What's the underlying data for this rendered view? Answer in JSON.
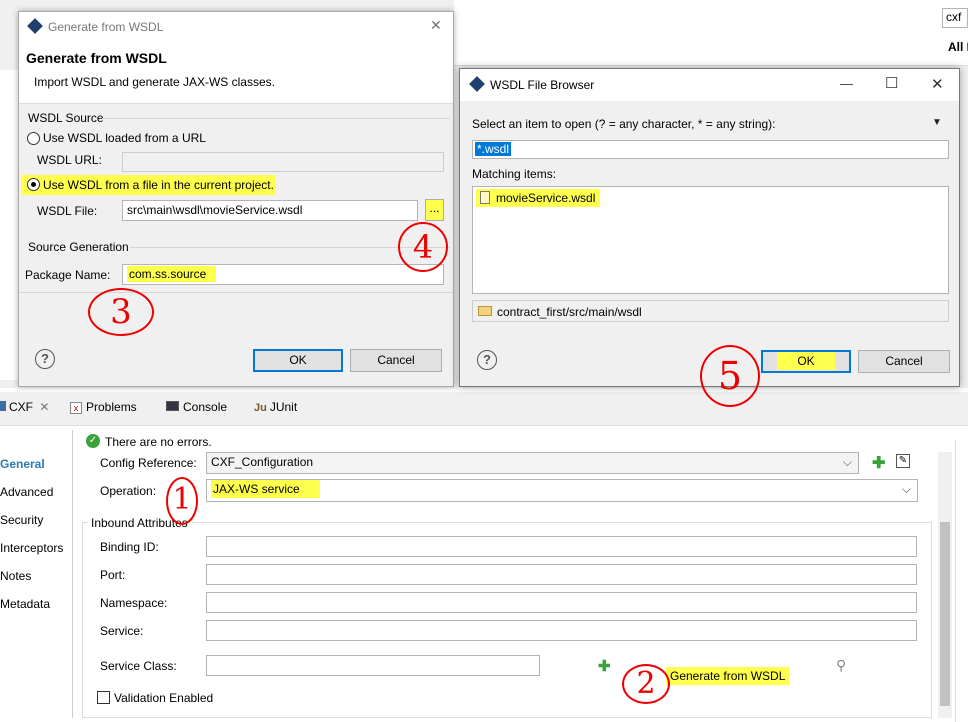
{
  "top_right": {
    "search_value": "cxf",
    "all_label": "All I"
  },
  "generate_dialog": {
    "title": "Generate from WSDL",
    "header_title": "Generate from WSDL",
    "header_desc": "Import WSDL and generate JAX-WS classes.",
    "wsdl_source_group": "WSDL Source",
    "radio_url": "Use WSDL loaded from a URL",
    "wsdl_url_label": "WSDL URL:",
    "wsdl_url_value": "",
    "radio_file": "Use WSDL from a file in the current project.",
    "wsdl_file_label": "WSDL File:",
    "wsdl_file_value": "src\\main\\wsdl\\movieService.wsdl",
    "browse_label": "...",
    "source_gen_group": "Source Generation",
    "package_label": "Package Name:",
    "package_value": "com.ss.source",
    "ok": "OK",
    "cancel": "Cancel",
    "help": "?"
  },
  "browser_dialog": {
    "title": "WSDL File Browser",
    "prompt": "Select an item to open (? = any character, * = any string):",
    "filter_value": "*.wsdl",
    "matching_label": "Matching items:",
    "items": [
      "movieService.wsdl"
    ],
    "folder_path": "contract_first/src/main/wsdl",
    "ok": "OK",
    "cancel": "Cancel",
    "help": "?",
    "minimize": "—",
    "maximize": "☐",
    "close": "✕"
  },
  "tabs": {
    "cxf": "CXF",
    "problems": "Problems",
    "console": "Console",
    "junit": "JUnit"
  },
  "sidebar": [
    "General",
    "Advanced",
    "Security",
    "Interceptors",
    "Notes",
    "Metadata"
  ],
  "config": {
    "status": "There are no errors.",
    "config_ref_label": "Config Reference:",
    "config_ref_value": "CXF_Configuration",
    "operation_label": "Operation:",
    "operation_value": "JAX-WS service",
    "inbound_group": "Inbound Attributes",
    "binding_label": "Binding ID:",
    "port_label": "Port:",
    "namespace_label": "Namespace:",
    "service_label": "Service:",
    "service_class_label": "Service Class:",
    "generate_link": "Generate from WSDL",
    "validation_label": "Validation Enabled"
  },
  "annotations": [
    "1",
    "2",
    "3",
    "4",
    "5"
  ],
  "colors": {
    "highlight": "#ffff4d",
    "annotation": "#e00000",
    "accent": "#0078d7"
  }
}
